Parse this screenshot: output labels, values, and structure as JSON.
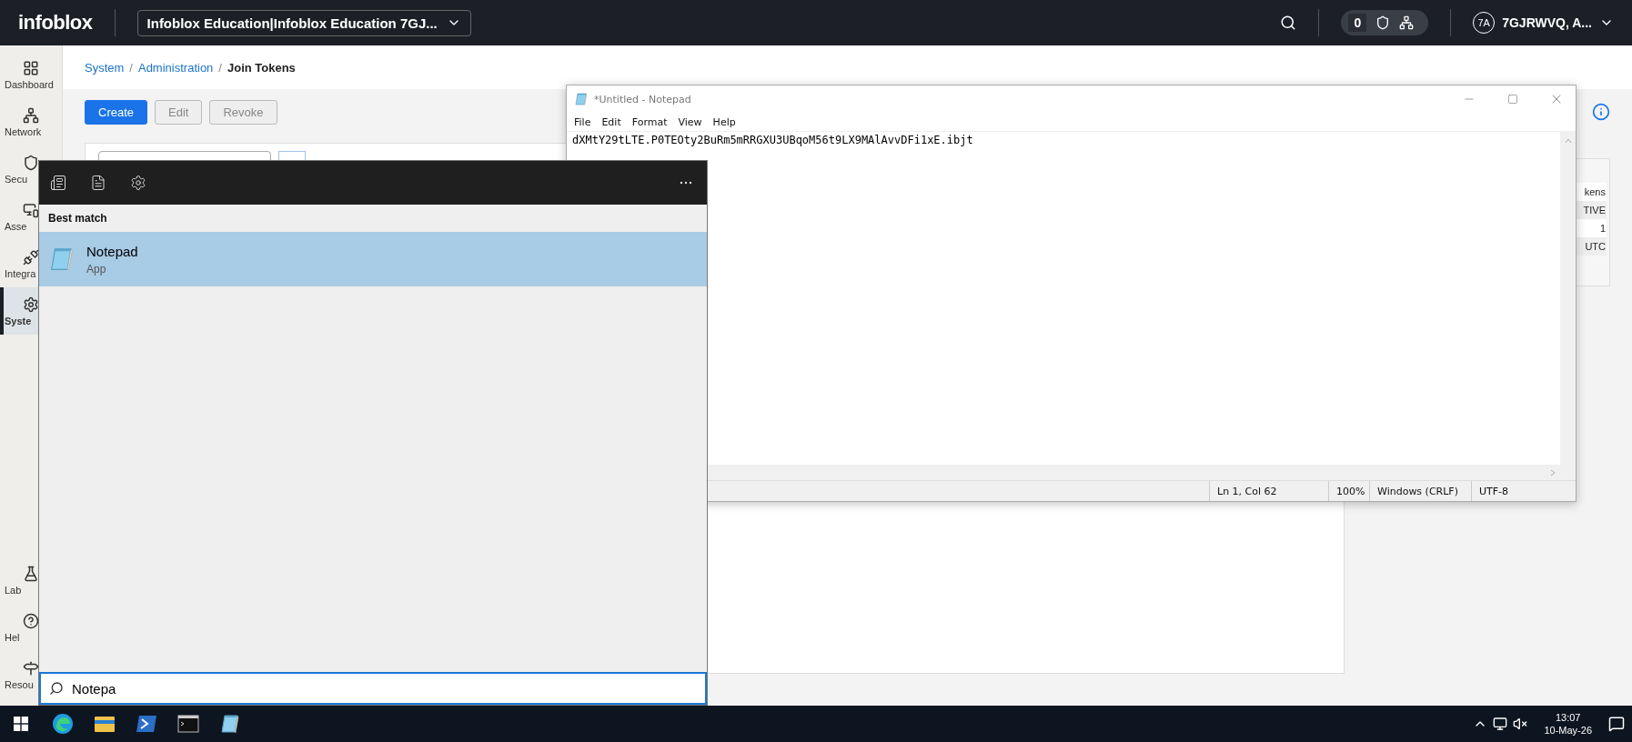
{
  "top_bar": {
    "logo": "infoblox",
    "account": "Infoblox Education|Infoblox Education 7GJ...",
    "alerts_count": "0",
    "avatar": "7A",
    "user": "7GJRWVQ, A..."
  },
  "sidebar": {
    "items": [
      {
        "label": "Dashboard",
        "kind": "grid",
        "selected": false
      },
      {
        "label": "Network",
        "kind": "network",
        "selected": false
      },
      {
        "label": "Secu",
        "kind": "shield",
        "selected": false
      },
      {
        "label": "Asse",
        "kind": "monitor",
        "selected": false
      },
      {
        "label": "Integra",
        "kind": "plug",
        "selected": false
      },
      {
        "label": "Syste",
        "kind": "gear",
        "selected": true
      }
    ],
    "bottom_items": [
      {
        "label": "Lab",
        "kind": "flask",
        "selected": false
      },
      {
        "label": "Hel",
        "kind": "help",
        "selected": false
      },
      {
        "label": "Resou",
        "kind": "signpost",
        "selected": false
      }
    ]
  },
  "breadcrumb": [
    {
      "label": "System",
      "kind": "link"
    },
    {
      "label": "/",
      "kind": "separator"
    },
    {
      "label": "Administration",
      "kind": "link"
    },
    {
      "label": "/",
      "kind": "separator"
    },
    {
      "label": "Join Tokens",
      "kind": "current"
    }
  ],
  "toolbar": {
    "buttons": [
      {
        "label": "Create",
        "disabled": false
      },
      {
        "label": "Edit",
        "disabled": true
      },
      {
        "label": "Revoke",
        "disabled": true
      }
    ]
  },
  "summary_card": {
    "rows": [
      "kens",
      "TIVE",
      "1",
      "UTC"
    ]
  },
  "notepad": {
    "title": "*Untitled - Notepad",
    "menu": [
      "File",
      "Edit",
      "Format",
      "View",
      "Help"
    ],
    "content": "dXMtY29tLTE.P0TEOty2BuRm5mRRGXU3UBqoM56t9LX9MAlAvvDFi1xE.ibjt",
    "status": [
      "Ln 1, Col 62",
      "100%",
      "Windows (CRLF)",
      "UTF-8"
    ]
  },
  "start_menu": {
    "section": "Best match",
    "results": [
      {
        "name": "Notepad",
        "type": "App",
        "selected": true
      }
    ],
    "search": {
      "value": "Notepa"
    }
  },
  "taskbar": {
    "apps": [
      {
        "kind": "edge"
      },
      {
        "kind": "explorer"
      },
      {
        "kind": "powershell"
      },
      {
        "kind": "terminal"
      },
      {
        "kind": "notepad"
      }
    ],
    "time": "13:07",
    "date": "10-May-26"
  }
}
